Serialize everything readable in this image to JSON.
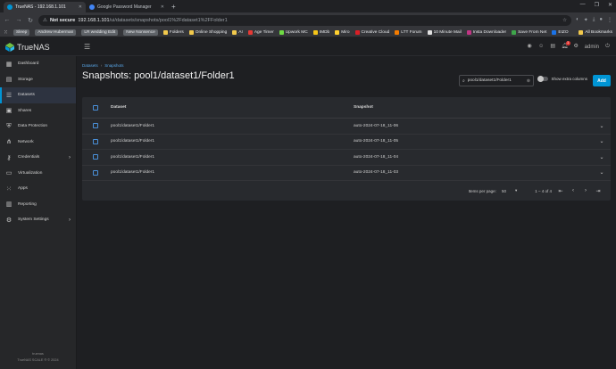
{
  "browser": {
    "tabs": [
      {
        "title": "TrueNAS - 192.168.1.101",
        "active": true
      },
      {
        "title": "Google Password Manager",
        "active": false
      }
    ],
    "address": {
      "security": "Not secure",
      "host": "192.168.1.101",
      "path": "/ui/datasets/snapshots/pool1%2Fdataset1%2FFolder1"
    },
    "bookmarks": [
      {
        "label": "Sleep",
        "pill": true,
        "color": "#5f6368"
      },
      {
        "label": "Andrew Huberman",
        "pill": true,
        "color": "#5f6368"
      },
      {
        "label": "LR wedding Edit",
        "pill": true,
        "color": "#5f6368"
      },
      {
        "label": "New Nonsence",
        "pill": true,
        "color": "#5f6368"
      },
      {
        "label": "Folders",
        "pill": false,
        "color": "#f2c94c"
      },
      {
        "label": "Online Shopping",
        "pill": false,
        "color": "#f2c94c"
      },
      {
        "label": "AI",
        "pill": false,
        "color": "#f2c94c"
      },
      {
        "label": "Age Timer",
        "pill": false,
        "color": "#e53935"
      },
      {
        "label": "Upwork MC",
        "pill": false,
        "color": "#6fda44"
      },
      {
        "label": "IMDb",
        "pill": false,
        "color": "#f5c518"
      },
      {
        "label": "Miro",
        "pill": false,
        "color": "#ffd02f"
      },
      {
        "label": "Creative Cloud",
        "pill": false,
        "color": "#da1f26"
      },
      {
        "label": "LTT Forum",
        "pill": false,
        "color": "#f57c00"
      },
      {
        "label": "10 Minute Mail",
        "pill": false,
        "color": "#e0e0e0"
      },
      {
        "label": "Insta Downloader",
        "pill": false,
        "color": "#c13584"
      },
      {
        "label": "Save From Net",
        "pill": false,
        "color": "#3ea64a"
      },
      {
        "label": "EIZO",
        "pill": false,
        "color": "#1a73e8"
      }
    ],
    "all_bookmarks": "All Bookmarks"
  },
  "app": {
    "logo_text": "TrueNAS",
    "user": "admin",
    "alert_count": "1",
    "sidebar": {
      "items": [
        {
          "label": "Dashboard",
          "icon": "dashboard-icon",
          "glyph": "▦",
          "active": false,
          "chevron": false
        },
        {
          "label": "Storage",
          "icon": "storage-icon",
          "glyph": "▤",
          "active": false,
          "chevron": false
        },
        {
          "label": "Datasets",
          "icon": "datasets-icon",
          "glyph": "☰",
          "active": true,
          "chevron": false
        },
        {
          "label": "Shares",
          "icon": "shares-icon",
          "glyph": "▣",
          "active": false,
          "chevron": false
        },
        {
          "label": "Data Protection",
          "icon": "shield-icon",
          "glyph": "⛨",
          "active": false,
          "chevron": false
        },
        {
          "label": "Network",
          "icon": "network-icon",
          "glyph": "⋔",
          "active": false,
          "chevron": false
        },
        {
          "label": "Credentials",
          "icon": "key-icon",
          "glyph": "⚷",
          "active": false,
          "chevron": true
        },
        {
          "label": "Virtualization",
          "icon": "monitor-icon",
          "glyph": "▭",
          "active": false,
          "chevron": false
        },
        {
          "label": "Apps",
          "icon": "apps-icon",
          "glyph": "⁙",
          "active": false,
          "chevron": false
        },
        {
          "label": "Reporting",
          "icon": "reporting-icon",
          "glyph": "▥",
          "active": false,
          "chevron": false
        },
        {
          "label": "System Settings",
          "icon": "gear-icon",
          "glyph": "⚙",
          "active": false,
          "chevron": true
        }
      ],
      "footer_host": "truenas",
      "footer_version": "TrueNAS SCALE ® © 2024"
    },
    "breadcrumb": [
      "Datasets",
      "Snapshots"
    ],
    "title": "Snapshots: pool1/dataset1/Folder1",
    "search": {
      "value": "pool1/dataset1/Folder1"
    },
    "toggle_label": "Show extra columns",
    "add_label": "Add",
    "table": {
      "columns": [
        "Dataset",
        "Snapshot"
      ],
      "rows": [
        {
          "dataset": "pool1/dataset1/Folder1",
          "snapshot": "auto-2024-07-18_11-06"
        },
        {
          "dataset": "pool1/dataset1/Folder1",
          "snapshot": "auto-2024-07-18_11-05"
        },
        {
          "dataset": "pool1/dataset1/Folder1",
          "snapshot": "auto-2024-07-18_11-04"
        },
        {
          "dataset": "pool1/dataset1/Folder1",
          "snapshot": "auto-2024-07-18_11-03"
        }
      ]
    },
    "paginator": {
      "items_per_page_label": "Items per page:",
      "items_per_page": "50",
      "range": "1 – 4 of 4"
    }
  }
}
